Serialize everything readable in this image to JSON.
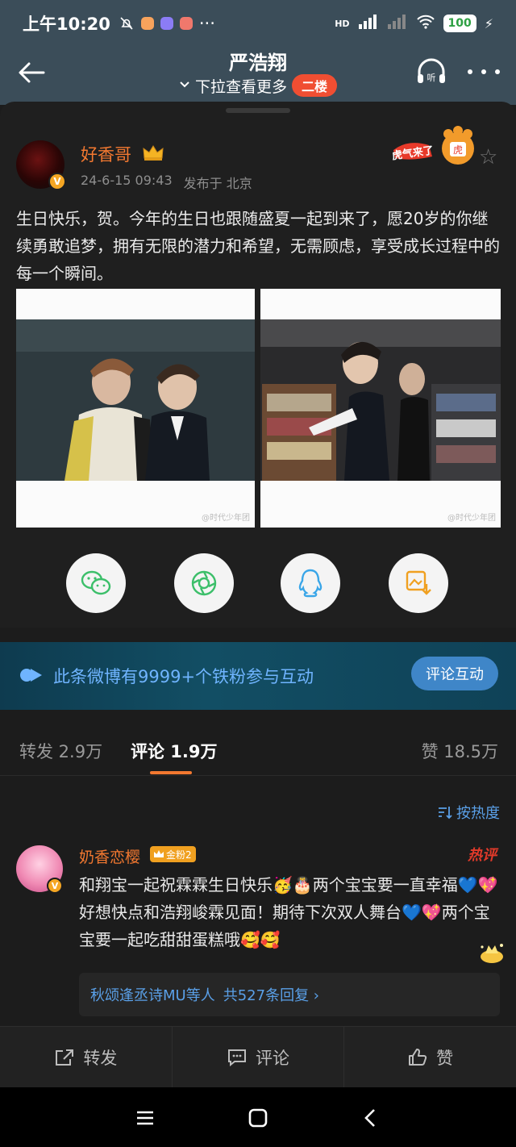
{
  "status_bar": {
    "time": "上午10:20",
    "network": "HD",
    "battery": "100"
  },
  "header": {
    "title": "严浩翔",
    "subtitle": "下拉查看更多",
    "floor_badge": "二楼"
  },
  "post": {
    "author": "好香哥",
    "date": "24-6-15 09:43",
    "location": "发布于 北京",
    "text": "生日快乐，贺。今年的生日也跟随盛夏一起到来了，愿20岁的你继续勇敢追梦，拥有无限的潜力和希望，无需顾虑，享受成长过程中的每一个瞬间。",
    "photo_watermark_1": "@时代少年团",
    "photo_watermark_2": "@时代少年团"
  },
  "share_buttons": [
    "wechat-icon",
    "moments-icon",
    "qq-icon",
    "save-image-icon"
  ],
  "banner": {
    "text": "此条微博有9999+个铁粉参与互动",
    "button": "评论互动"
  },
  "tabs": {
    "repost": "转发 2.9万",
    "comment": "评论 1.9万",
    "like": "赞 18.5万"
  },
  "sort_label": "按热度",
  "comment": {
    "author": "奶香恋樱",
    "fan_badge": "金粉2",
    "hot_label": "热评",
    "text": "和翔宝一起祝霖霖生日快乐🥳🎂两个宝宝要一直幸福💙💖好想快点和浩翔峻霖见面！期待下次双人舞台💙💖两个宝宝要一起吃甜甜蛋糕哦🥰🥰",
    "replies_users": "秋颂逢丞诗MU等人",
    "replies_count": "共527条回复 ›"
  },
  "action_bar": {
    "repost": "转发",
    "comment": "评论",
    "like": "赞"
  },
  "colors": {
    "accent_orange": "#f27830",
    "link_blue": "#5aa0e8",
    "header_bg": "#3b4d59",
    "hot_red": "#e03a2a"
  }
}
